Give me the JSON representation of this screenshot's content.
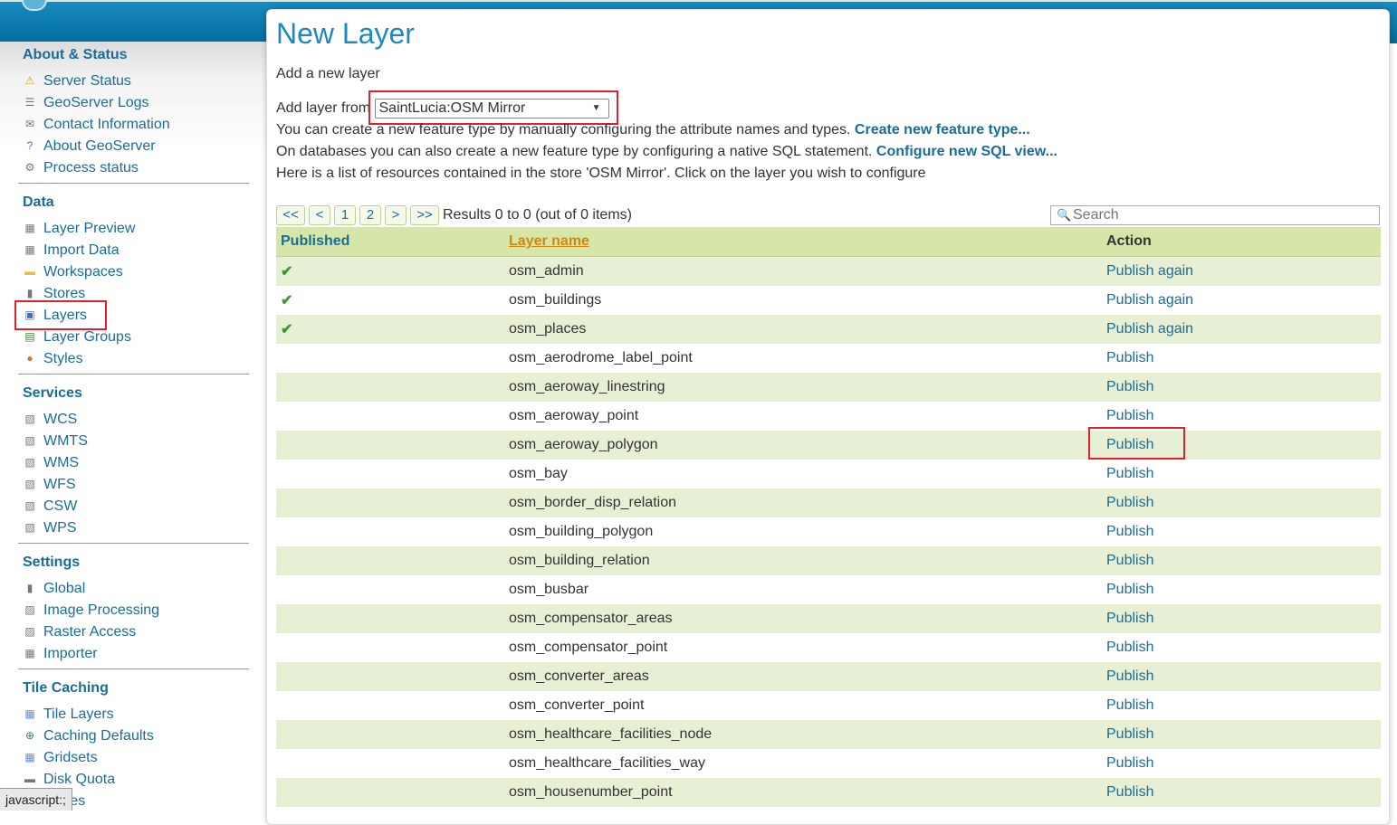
{
  "sidebar": {
    "sections": [
      {
        "title": "About & Status",
        "items": [
          {
            "label": "Server Status",
            "icon": "warning-icon"
          },
          {
            "label": "GeoServer Logs",
            "icon": "document-icon"
          },
          {
            "label": "Contact Information",
            "icon": "contact-card-icon"
          },
          {
            "label": "About GeoServer",
            "icon": "help-icon"
          },
          {
            "label": "Process status",
            "icon": "gear-icon"
          }
        ]
      },
      {
        "title": "Data",
        "items": [
          {
            "label": "Layer Preview",
            "icon": "map-preview-icon"
          },
          {
            "label": "Import Data",
            "icon": "map-import-icon"
          },
          {
            "label": "Workspaces",
            "icon": "folder-icon"
          },
          {
            "label": "Stores",
            "icon": "database-icon"
          },
          {
            "label": "Layers",
            "icon": "layer-icon"
          },
          {
            "label": "Layer Groups",
            "icon": "layer-group-icon"
          },
          {
            "label": "Styles",
            "icon": "palette-icon"
          }
        ]
      },
      {
        "title": "Services",
        "items": [
          {
            "label": "WCS",
            "icon": "service-icon"
          },
          {
            "label": "WMTS",
            "icon": "service-icon"
          },
          {
            "label": "WMS",
            "icon": "service-icon"
          },
          {
            "label": "WFS",
            "icon": "service-icon"
          },
          {
            "label": "CSW",
            "icon": "service-icon"
          },
          {
            "label": "WPS",
            "icon": "service-icon"
          }
        ]
      },
      {
        "title": "Settings",
        "items": [
          {
            "label": "Global",
            "icon": "server-icon"
          },
          {
            "label": "Image Processing",
            "icon": "image-icon"
          },
          {
            "label": "Raster Access",
            "icon": "raster-icon"
          },
          {
            "label": "Importer",
            "icon": "import-icon"
          }
        ]
      },
      {
        "title": "Tile Caching",
        "items": [
          {
            "label": "Tile Layers",
            "icon": "tiles-icon"
          },
          {
            "label": "Caching Defaults",
            "icon": "globe-icon"
          },
          {
            "label": "Gridsets",
            "icon": "grid-icon"
          },
          {
            "label": "Disk Quota",
            "icon": "disk-icon"
          },
          {
            "label": "Stores",
            "icon": "database-icon"
          }
        ]
      }
    ]
  },
  "main": {
    "title": "New Layer",
    "subtitle": "Add a new layer",
    "add_from_label": "Add layer from",
    "store_value": "SaintLucia:OSM Mirror",
    "line_feature_text": "You can create a new feature type by manually configuring the attribute names and types.",
    "line_feature_link": "Create new feature type...",
    "line_sql_text": "On databases you can also create a new feature type by configuring a native SQL statement.",
    "line_sql_link": "Configure new SQL view...",
    "line_resources": "Here is a list of resources contained in the store 'OSM Mirror'. Click on the layer you wish to configure",
    "pager": {
      "first": "<<",
      "prev": "<",
      "page1": "1",
      "page2": "2",
      "next": ">",
      "last": ">>"
    },
    "results": "Results 0 to 0 (out of 0 items)",
    "search_placeholder": "Search",
    "table": {
      "headers": {
        "published": "Published",
        "name": "Layer name",
        "action": "Action"
      },
      "rows": [
        {
          "published": true,
          "name": "osm_admin",
          "action": "Publish again"
        },
        {
          "published": true,
          "name": "osm_buildings",
          "action": "Publish again"
        },
        {
          "published": true,
          "name": "osm_places",
          "action": "Publish again"
        },
        {
          "published": false,
          "name": "osm_aerodrome_label_point",
          "action": "Publish"
        },
        {
          "published": false,
          "name": "osm_aeroway_linestring",
          "action": "Publish"
        },
        {
          "published": false,
          "name": "osm_aeroway_point",
          "action": "Publish"
        },
        {
          "published": false,
          "name": "osm_aeroway_polygon",
          "action": "Publish"
        },
        {
          "published": false,
          "name": "osm_bay",
          "action": "Publish"
        },
        {
          "published": false,
          "name": "osm_border_disp_relation",
          "action": "Publish"
        },
        {
          "published": false,
          "name": "osm_building_polygon",
          "action": "Publish"
        },
        {
          "published": false,
          "name": "osm_building_relation",
          "action": "Publish"
        },
        {
          "published": false,
          "name": "osm_busbar",
          "action": "Publish"
        },
        {
          "published": false,
          "name": "osm_compensator_areas",
          "action": "Publish"
        },
        {
          "published": false,
          "name": "osm_compensator_point",
          "action": "Publish"
        },
        {
          "published": false,
          "name": "osm_converter_areas",
          "action": "Publish"
        },
        {
          "published": false,
          "name": "osm_converter_point",
          "action": "Publish"
        },
        {
          "published": false,
          "name": "osm_healthcare_facilities_node",
          "action": "Publish"
        },
        {
          "published": false,
          "name": "osm_healthcare_facilities_way",
          "action": "Publish"
        },
        {
          "published": false,
          "name": "osm_housenumber_point",
          "action": "Publish"
        }
      ]
    }
  },
  "status_bar": "javascript:;",
  "colors": {
    "link": "#1a6d99",
    "title": "#1a8bc0",
    "row_alt": "#e7f0d4",
    "header": "#d5e6a8",
    "highlight": "#e0202a"
  }
}
